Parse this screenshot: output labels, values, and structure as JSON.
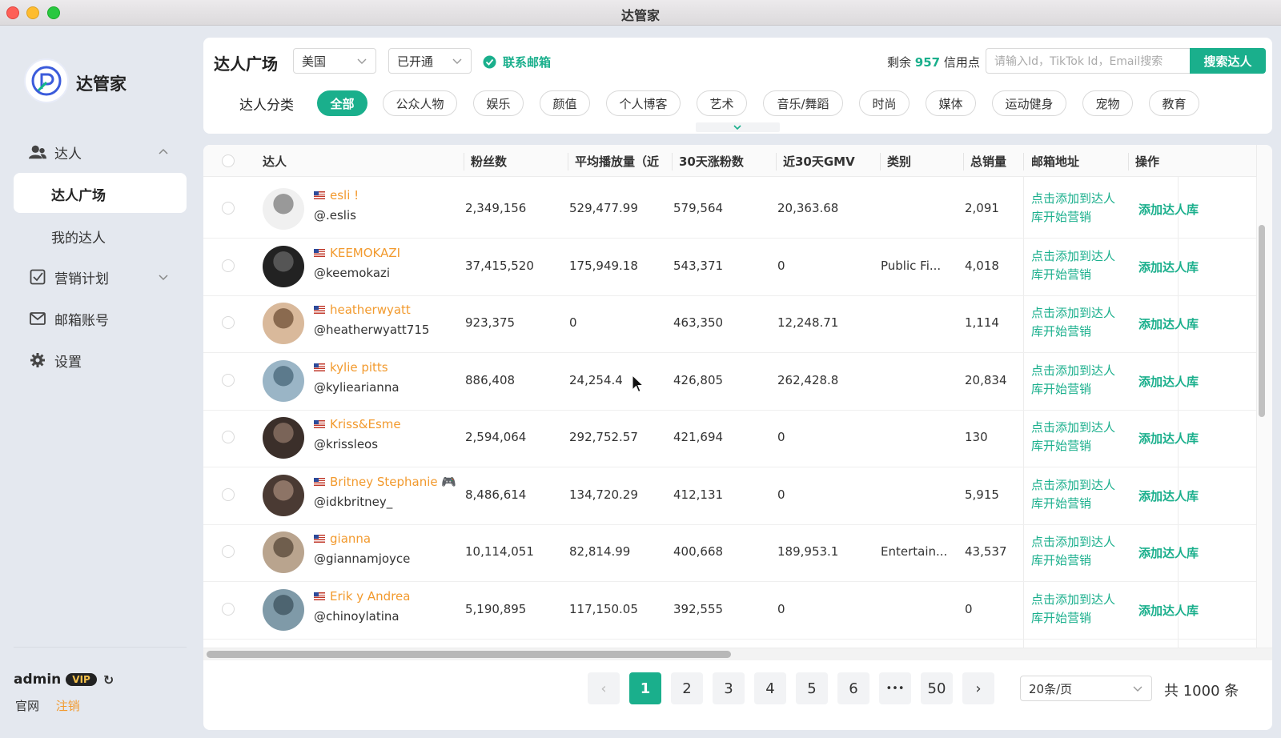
{
  "window": {
    "title": "达管家"
  },
  "brand": {
    "name": "达管家",
    "accent": "#1aaf8c",
    "nick_color": "#f29a2e"
  },
  "sidebar": {
    "group_influencer": "达人",
    "sub_plaza": "达人广场",
    "sub_mine": "我的达人",
    "marketing": "营销计划",
    "mail": "邮箱账号",
    "settings": "设置",
    "user": "admin",
    "vip": "VIP",
    "link_official": "官网",
    "link_logout": "注销"
  },
  "toolbar": {
    "title": "达人广场",
    "country": "美国",
    "status": "已开通",
    "contact_email": "联系邮箱",
    "credits_prefix": "剩余",
    "credits_value": "957",
    "credits_suffix": "信用点",
    "search_placeholder": "请输入Id，TikTok Id，Email搜索",
    "search_button": "搜索达人"
  },
  "categories": {
    "label": "达人分类",
    "items": [
      "全部",
      "公众人物",
      "娱乐",
      "颜值",
      "个人博客",
      "艺术",
      "音乐/舞蹈",
      "时尚",
      "媒体",
      "运动健身",
      "宠物",
      "教育"
    ],
    "active": "全部"
  },
  "table": {
    "headers": [
      "达人",
      "粉丝数",
      "平均播放量（近",
      "30天涨粉数",
      "近30天GMV",
      "类别",
      "总销量",
      "邮箱地址",
      "操作"
    ],
    "email_link": "点击添加到达人库开始营销",
    "action_link": "添加达人库",
    "rows": [
      {
        "nick": "esli !",
        "handle": "@.eslis",
        "followers": "2,349,156",
        "avg_views": "529,477.99",
        "growth": "579,564",
        "gmv": "20,363.68",
        "category": "",
        "sales": "2,091"
      },
      {
        "nick": "KEEMOKAZI",
        "handle": "@keemokazi",
        "followers": "37,415,520",
        "avg_views": "175,949.18",
        "growth": "543,371",
        "gmv": "0",
        "category": "Public Fi...",
        "sales": "4,018"
      },
      {
        "nick": "heatherwyatt",
        "handle": "@heatherwyatt715",
        "followers": "923,375",
        "avg_views": "0",
        "growth": "463,350",
        "gmv": "12,248.71",
        "category": "",
        "sales": "1,114"
      },
      {
        "nick": "kylie pitts",
        "handle": "@kyliearianna",
        "followers": "886,408",
        "avg_views": "24,254.4",
        "growth": "426,805",
        "gmv": "262,428.8",
        "category": "",
        "sales": "20,834"
      },
      {
        "nick": "Kriss&Esme",
        "handle": "@krissleos",
        "followers": "2,594,064",
        "avg_views": "292,752.57",
        "growth": "421,694",
        "gmv": "0",
        "category": "",
        "sales": "130"
      },
      {
        "nick": "Britney Stephanie 🎮",
        "handle": "@idkbritney_",
        "followers": "8,486,614",
        "avg_views": "134,720.29",
        "growth": "412,131",
        "gmv": "0",
        "category": "",
        "sales": "5,915"
      },
      {
        "nick": "gianna",
        "handle": "@giannamjoyce",
        "followers": "10,114,051",
        "avg_views": "82,814.99",
        "growth": "400,668",
        "gmv": "189,953.1",
        "category": "Entertain...",
        "sales": "43,537"
      },
      {
        "nick": "Erik y Andrea",
        "handle": "@chinoylatina",
        "followers": "5,190,895",
        "avg_views": "117,150.05",
        "growth": "392,555",
        "gmv": "0",
        "category": "",
        "sales": "0"
      }
    ]
  },
  "pagination": {
    "pages": [
      "1",
      "2",
      "3",
      "4",
      "5",
      "6",
      "•••",
      "50"
    ],
    "current": "1",
    "page_size": "20条/页",
    "total": "共 1000 条"
  }
}
